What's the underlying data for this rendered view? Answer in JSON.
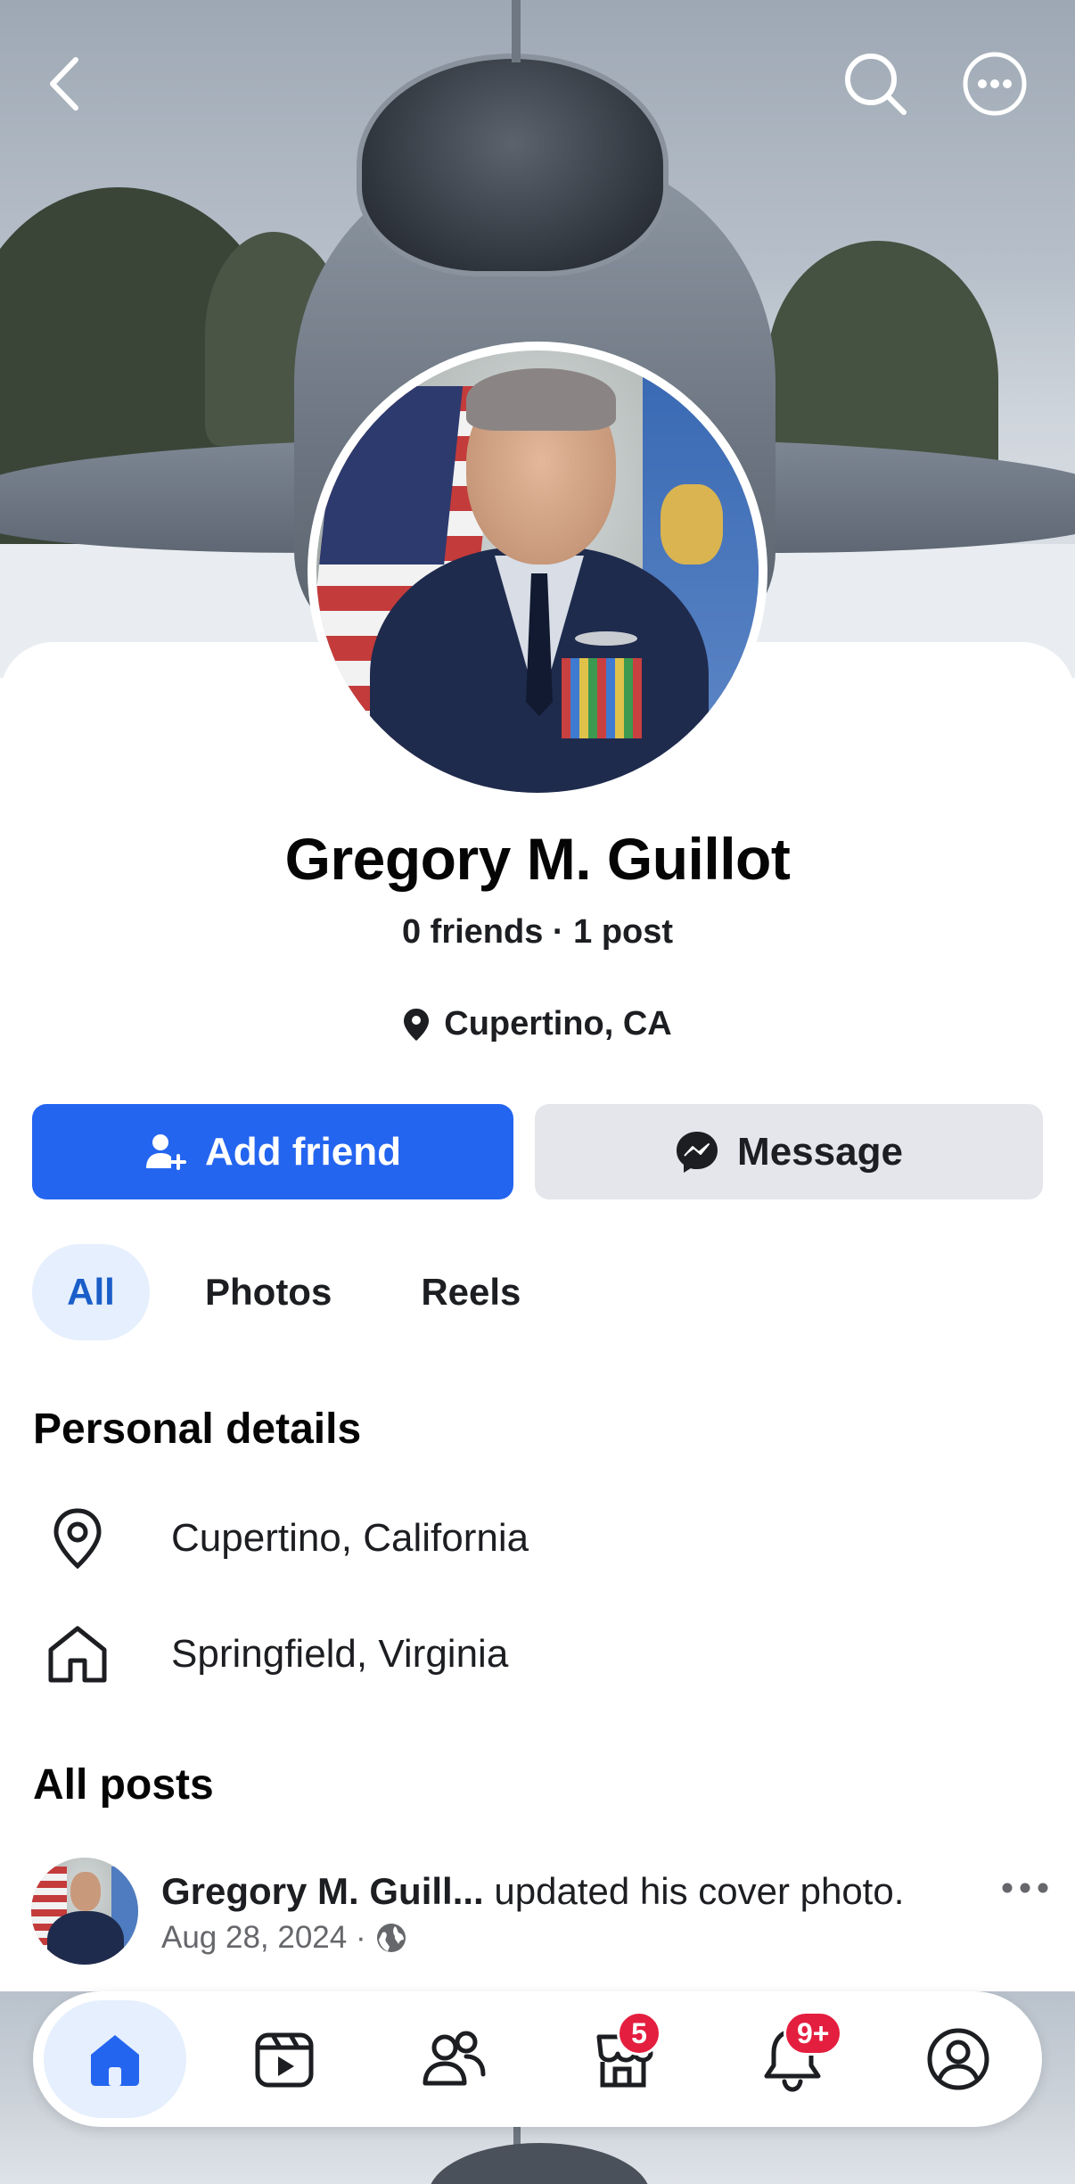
{
  "cover": {
    "back_icon": "chevron-left-icon",
    "search_icon": "search-icon",
    "more_icon": "more-horizontal-icon"
  },
  "profile": {
    "name": "Gregory M. Guillot",
    "stats": "0 friends · 1 post",
    "location": "Cupertino, CA"
  },
  "actions": {
    "add_friend_label": "Add friend",
    "message_label": "Message"
  },
  "tabs": [
    {
      "label": "All",
      "active": true
    },
    {
      "label": "Photos",
      "active": false
    },
    {
      "label": "Reels",
      "active": false
    }
  ],
  "personal_details": {
    "title": "Personal details",
    "items": [
      {
        "icon": "location-pin-icon",
        "text": "Cupertino, California"
      },
      {
        "icon": "home-icon",
        "text": "Springfield, Virginia"
      }
    ]
  },
  "all_posts": {
    "title": "All posts",
    "posts": [
      {
        "author": "Gregory M. Guill...",
        "action": " updated his cover photo.",
        "date": "Aug 28, 2024 ·",
        "privacy_icon": "globe-icon"
      }
    ]
  },
  "bottom_nav": {
    "items": [
      {
        "icon": "home-icon",
        "active": true
      },
      {
        "icon": "video-icon",
        "active": false
      },
      {
        "icon": "friends-icon",
        "active": false
      },
      {
        "icon": "marketplace-icon",
        "active": false,
        "badge": "5"
      },
      {
        "icon": "bell-icon",
        "active": false,
        "badge": "9+"
      },
      {
        "icon": "profile-icon",
        "active": false
      }
    ]
  },
  "colors": {
    "primary_blue": "#2465f0",
    "active_tab_bg": "#e5effd",
    "active_tab_text": "#1a5ec9",
    "badge_red": "#e41e3f",
    "secondary_button": "#e4e6eb"
  }
}
